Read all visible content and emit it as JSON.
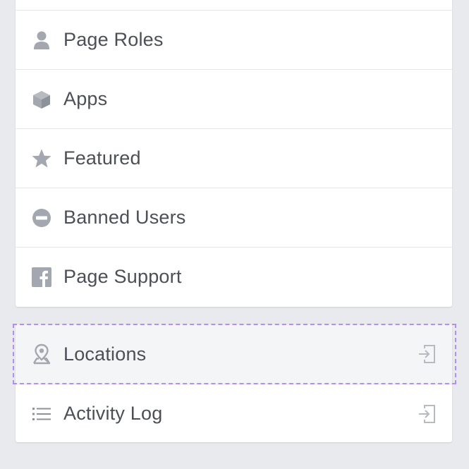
{
  "menu": {
    "items": [
      {
        "id": "page-roles",
        "label": "Page Roles",
        "icon": "person-icon"
      },
      {
        "id": "apps",
        "label": "Apps",
        "icon": "cube-icon"
      },
      {
        "id": "featured",
        "label": "Featured",
        "icon": "star-icon"
      },
      {
        "id": "banned-users",
        "label": "Banned Users",
        "icon": "no-entry-icon"
      },
      {
        "id": "page-support",
        "label": "Page Support",
        "icon": "facebook-icon"
      }
    ]
  },
  "links": {
    "items": [
      {
        "id": "locations",
        "label": "Locations",
        "icon": "location-pin-icon",
        "action_icon": "exit-icon"
      },
      {
        "id": "activity-log",
        "label": "Activity Log",
        "icon": "list-icon",
        "action_icon": "exit-icon"
      }
    ]
  },
  "colors": {
    "background": "#e9eaed",
    "card": "#ffffff",
    "text": "#4b4f56",
    "icon": "#a2a7b0",
    "highlight_border": "#b58ef1"
  }
}
